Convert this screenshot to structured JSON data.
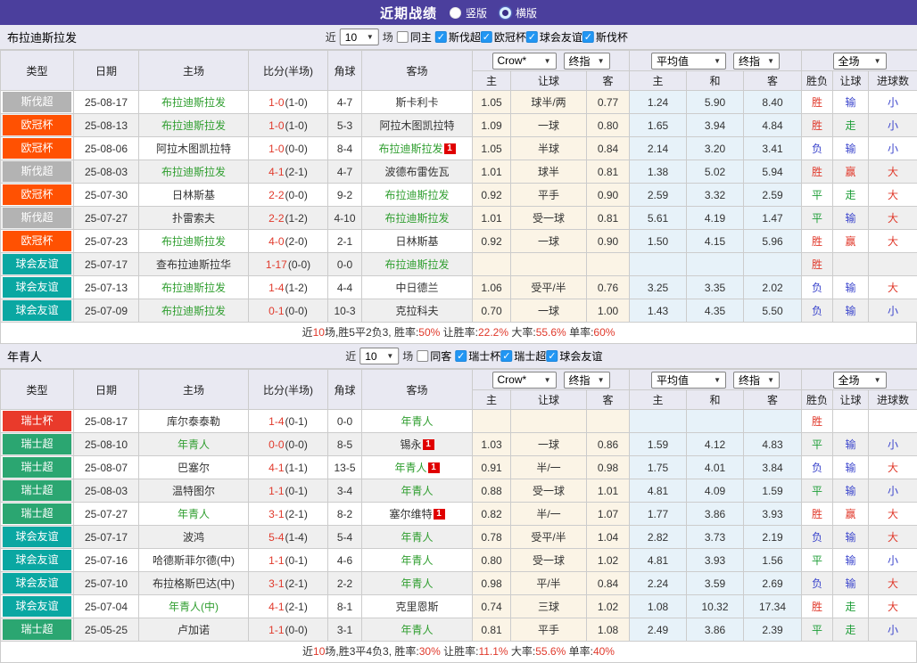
{
  "titlebar": {
    "title": "近期战绩",
    "radios": [
      {
        "label": "竖版",
        "checked": true
      },
      {
        "label": "横版",
        "checked": false
      }
    ]
  },
  "header": {
    "near_label": "近",
    "near_value": "10",
    "games_label": "场",
    "static_cols": [
      "类型",
      "日期",
      "主场",
      "比分(半场)",
      "角球",
      "客场"
    ],
    "selects": {
      "crow": "Crow*",
      "final1": "终指",
      "avg": "平均值",
      "final2": "终指",
      "scope": "全场"
    },
    "odds_cols": [
      "主",
      "让球",
      "客"
    ],
    "avg_cols": [
      "主",
      "和",
      "客"
    ],
    "result_cols": [
      "胜负",
      "让球",
      "进球数"
    ]
  },
  "league_colors": {
    "斯伐超": "#b3b3b3",
    "欧冠杯": "#ff5102",
    "球会友谊": "#0aa7a2",
    "瑞士杯": "#e93a2b",
    "瑞士超": "#2ba671"
  },
  "result_colors": {
    "red": "#e0392b",
    "green": "#1f9e38",
    "blue": "#3b45cc"
  },
  "sections": [
    {
      "team": "布拉迪斯拉发",
      "same_label": "同主",
      "same_checked": false,
      "leagues": [
        {
          "label": "斯伐超",
          "checked": true
        },
        {
          "label": "欧冠杯",
          "checked": true
        },
        {
          "label": "球会友谊",
          "checked": true
        },
        {
          "label": "斯伐杯",
          "checked": true
        }
      ],
      "rows": [
        {
          "league": "斯伐超",
          "date": "25-08-17",
          "home": "布拉迪斯拉发",
          "home_self": true,
          "home_card": 0,
          "score": "1-0",
          "half": "(1-0)",
          "corner": "4-7",
          "away": "斯卡利卡",
          "away_self": false,
          "away_card": 0,
          "odds": [
            "1.05",
            "球半/两",
            "0.77"
          ],
          "avg": [
            "1.24",
            "5.90",
            "8.40"
          ],
          "results": [
            [
              "胜",
              "red"
            ],
            [
              "输",
              "blue"
            ],
            [
              "小",
              "blue"
            ]
          ]
        },
        {
          "league": "欧冠杯",
          "date": "25-08-13",
          "home": "布拉迪斯拉发",
          "home_self": true,
          "home_card": 0,
          "score": "1-0",
          "half": "(1-0)",
          "corner": "5-3",
          "away": "阿拉木图凯拉特",
          "away_self": false,
          "away_card": 0,
          "odds": [
            "1.09",
            "一球",
            "0.80"
          ],
          "avg": [
            "1.65",
            "3.94",
            "4.84"
          ],
          "results": [
            [
              "胜",
              "red"
            ],
            [
              "走",
              "green"
            ],
            [
              "小",
              "blue"
            ]
          ]
        },
        {
          "league": "欧冠杯",
          "date": "25-08-06",
          "home": "阿拉木图凯拉特",
          "home_self": false,
          "home_card": 0,
          "score": "1-0",
          "half": "(0-0)",
          "corner": "8-4",
          "away": "布拉迪斯拉发",
          "away_self": true,
          "away_card": 1,
          "odds": [
            "1.05",
            "半球",
            "0.84"
          ],
          "avg": [
            "2.14",
            "3.20",
            "3.41"
          ],
          "results": [
            [
              "负",
              "blue"
            ],
            [
              "输",
              "blue"
            ],
            [
              "小",
              "blue"
            ]
          ]
        },
        {
          "league": "斯伐超",
          "date": "25-08-03",
          "home": "布拉迪斯拉发",
          "home_self": true,
          "home_card": 0,
          "score": "4-1",
          "half": "(2-1)",
          "corner": "4-7",
          "away": "波德布雷佐瓦",
          "away_self": false,
          "away_card": 0,
          "odds": [
            "1.01",
            "球半",
            "0.81"
          ],
          "avg": [
            "1.38",
            "5.02",
            "5.94"
          ],
          "results": [
            [
              "胜",
              "red"
            ],
            [
              "赢",
              "red"
            ],
            [
              "大",
              "red"
            ]
          ]
        },
        {
          "league": "欧冠杯",
          "date": "25-07-30",
          "home": "日林斯基",
          "home_self": false,
          "home_card": 0,
          "score": "2-2",
          "half": "(0-0)",
          "corner": "9-2",
          "away": "布拉迪斯拉发",
          "away_self": true,
          "away_card": 0,
          "odds": [
            "0.92",
            "平手",
            "0.90"
          ],
          "avg": [
            "2.59",
            "3.32",
            "2.59"
          ],
          "results": [
            [
              "平",
              "green"
            ],
            [
              "走",
              "green"
            ],
            [
              "大",
              "red"
            ]
          ]
        },
        {
          "league": "斯伐超",
          "date": "25-07-27",
          "home": "扑雷索夫",
          "home_self": false,
          "home_card": 0,
          "score": "2-2",
          "half": "(1-2)",
          "corner": "4-10",
          "away": "布拉迪斯拉发",
          "away_self": true,
          "away_card": 0,
          "odds": [
            "1.01",
            "受一球",
            "0.81"
          ],
          "avg": [
            "5.61",
            "4.19",
            "1.47"
          ],
          "results": [
            [
              "平",
              "green"
            ],
            [
              "输",
              "blue"
            ],
            [
              "大",
              "red"
            ]
          ]
        },
        {
          "league": "欧冠杯",
          "date": "25-07-23",
          "home": "布拉迪斯拉发",
          "home_self": true,
          "home_card": 0,
          "score": "4-0",
          "half": "(2-0)",
          "corner": "2-1",
          "away": "日林斯基",
          "away_self": false,
          "away_card": 0,
          "odds": [
            "0.92",
            "一球",
            "0.90"
          ],
          "avg": [
            "1.50",
            "4.15",
            "5.96"
          ],
          "results": [
            [
              "胜",
              "red"
            ],
            [
              "赢",
              "red"
            ],
            [
              "大",
              "red"
            ]
          ]
        },
        {
          "league": "球会友谊",
          "date": "25-07-17",
          "home": "查布拉迪斯拉华",
          "home_self": false,
          "home_card": 0,
          "score": "1-17",
          "half": "(0-0)",
          "corner": "0-0",
          "away": "布拉迪斯拉发",
          "away_self": true,
          "away_card": 0,
          "odds": [
            "",
            "",
            ""
          ],
          "avg": [
            "",
            "",
            ""
          ],
          "results": [
            [
              "胜",
              "red"
            ],
            [
              "",
              ""
            ],
            [
              "",
              ""
            ]
          ]
        },
        {
          "league": "球会友谊",
          "date": "25-07-13",
          "home": "布拉迪斯拉发",
          "home_self": true,
          "home_card": 0,
          "score": "1-4",
          "half": "(1-2)",
          "corner": "4-4",
          "away": "中日德兰",
          "away_self": false,
          "away_card": 0,
          "odds": [
            "1.06",
            "受平/半",
            "0.76"
          ],
          "avg": [
            "3.25",
            "3.35",
            "2.02"
          ],
          "results": [
            [
              "负",
              "blue"
            ],
            [
              "输",
              "blue"
            ],
            [
              "大",
              "red"
            ]
          ]
        },
        {
          "league": "球会友谊",
          "date": "25-07-09",
          "home": "布拉迪斯拉发",
          "home_self": true,
          "home_card": 0,
          "score": "0-1",
          "half": "(0-0)",
          "corner": "10-3",
          "away": "克拉科夫",
          "away_self": false,
          "away_card": 0,
          "odds": [
            "0.70",
            "一球",
            "1.00"
          ],
          "avg": [
            "1.43",
            "4.35",
            "5.50"
          ],
          "results": [
            [
              "负",
              "blue"
            ],
            [
              "输",
              "blue"
            ],
            [
              "小",
              "blue"
            ]
          ]
        }
      ],
      "summary": [
        [
          "近",
          "k"
        ],
        [
          "10",
          "r"
        ],
        [
          "场,胜5平2负3, 胜率:",
          "k"
        ],
        [
          "50%",
          "r"
        ],
        [
          " 让胜率:",
          "k"
        ],
        [
          "22.2%",
          "r"
        ],
        [
          " 大率:",
          "k"
        ],
        [
          "55.6%",
          "r"
        ],
        [
          " 单率:",
          "k"
        ],
        [
          "60%",
          "r"
        ]
      ]
    },
    {
      "team": "年青人",
      "same_label": "同客",
      "same_checked": false,
      "leagues": [
        {
          "label": "瑞士杯",
          "checked": true
        },
        {
          "label": "瑞士超",
          "checked": true
        },
        {
          "label": "球会友谊",
          "checked": true
        }
      ],
      "rows": [
        {
          "league": "瑞士杯",
          "date": "25-08-17",
          "home": "库尔泰泰勒",
          "home_self": false,
          "home_card": 0,
          "score": "1-4",
          "half": "(0-1)",
          "corner": "0-0",
          "away": "年青人",
          "away_self": true,
          "away_card": 0,
          "odds": [
            "",
            "",
            ""
          ],
          "avg": [
            "",
            "",
            ""
          ],
          "results": [
            [
              "胜",
              "red"
            ],
            [
              "",
              ""
            ],
            [
              "",
              ""
            ]
          ]
        },
        {
          "league": "瑞士超",
          "date": "25-08-10",
          "home": "年青人",
          "home_self": true,
          "home_card": 0,
          "score": "0-0",
          "half": "(0-0)",
          "corner": "8-5",
          "away": "锡永",
          "away_self": false,
          "away_card": 1,
          "odds": [
            "1.03",
            "一球",
            "0.86"
          ],
          "avg": [
            "1.59",
            "4.12",
            "4.83"
          ],
          "results": [
            [
              "平",
              "green"
            ],
            [
              "输",
              "blue"
            ],
            [
              "小",
              "blue"
            ]
          ]
        },
        {
          "league": "瑞士超",
          "date": "25-08-07",
          "home": "巴塞尔",
          "home_self": false,
          "home_card": 0,
          "score": "4-1",
          "half": "(1-1)",
          "corner": "13-5",
          "away": "年青人",
          "away_self": true,
          "away_card": 1,
          "odds": [
            "0.91",
            "半/一",
            "0.98"
          ],
          "avg": [
            "1.75",
            "4.01",
            "3.84"
          ],
          "results": [
            [
              "负",
              "blue"
            ],
            [
              "输",
              "blue"
            ],
            [
              "大",
              "red"
            ]
          ]
        },
        {
          "league": "瑞士超",
          "date": "25-08-03",
          "home": "温特图尔",
          "home_self": false,
          "home_card": 0,
          "score": "1-1",
          "half": "(0-1)",
          "corner": "3-4",
          "away": "年青人",
          "away_self": true,
          "away_card": 0,
          "odds": [
            "0.88",
            "受一球",
            "1.01"
          ],
          "avg": [
            "4.81",
            "4.09",
            "1.59"
          ],
          "results": [
            [
              "平",
              "green"
            ],
            [
              "输",
              "blue"
            ],
            [
              "小",
              "blue"
            ]
          ]
        },
        {
          "league": "瑞士超",
          "date": "25-07-27",
          "home": "年青人",
          "home_self": true,
          "home_card": 0,
          "score": "3-1",
          "half": "(2-1)",
          "corner": "8-2",
          "away": "塞尔维特",
          "away_self": false,
          "away_card": 1,
          "odds": [
            "0.82",
            "半/一",
            "1.07"
          ],
          "avg": [
            "1.77",
            "3.86",
            "3.93"
          ],
          "results": [
            [
              "胜",
              "red"
            ],
            [
              "赢",
              "red"
            ],
            [
              "大",
              "red"
            ]
          ]
        },
        {
          "league": "球会友谊",
          "date": "25-07-17",
          "home": "波鸿",
          "home_self": false,
          "home_card": 0,
          "score": "5-4",
          "half": "(1-4)",
          "corner": "5-4",
          "away": "年青人",
          "away_self": true,
          "away_card": 0,
          "odds": [
            "0.78",
            "受平/半",
            "1.04"
          ],
          "avg": [
            "2.82",
            "3.73",
            "2.19"
          ],
          "results": [
            [
              "负",
              "blue"
            ],
            [
              "输",
              "blue"
            ],
            [
              "大",
              "red"
            ]
          ]
        },
        {
          "league": "球会友谊",
          "date": "25-07-16",
          "home": "哈德斯菲尔德(中)",
          "home_self": false,
          "home_card": 0,
          "score": "1-1",
          "half": "(0-1)",
          "corner": "4-6",
          "away": "年青人",
          "away_self": true,
          "away_card": 0,
          "odds": [
            "0.80",
            "受一球",
            "1.02"
          ],
          "avg": [
            "4.81",
            "3.93",
            "1.56"
          ],
          "results": [
            [
              "平",
              "green"
            ],
            [
              "输",
              "blue"
            ],
            [
              "小",
              "blue"
            ]
          ]
        },
        {
          "league": "球会友谊",
          "date": "25-07-10",
          "home": "布拉格斯巴达(中)",
          "home_self": false,
          "home_card": 0,
          "score": "3-1",
          "half": "(2-1)",
          "corner": "2-2",
          "away": "年青人",
          "away_self": true,
          "away_card": 0,
          "odds": [
            "0.98",
            "平/半",
            "0.84"
          ],
          "avg": [
            "2.24",
            "3.59",
            "2.69"
          ],
          "results": [
            [
              "负",
              "blue"
            ],
            [
              "输",
              "blue"
            ],
            [
              "大",
              "red"
            ]
          ]
        },
        {
          "league": "球会友谊",
          "date": "25-07-04",
          "home": "年青人(中)",
          "home_self": true,
          "home_card": 0,
          "score": "4-1",
          "half": "(2-1)",
          "corner": "8-1",
          "away": "克里恩斯",
          "away_self": false,
          "away_card": 0,
          "odds": [
            "0.74",
            "三球",
            "1.02"
          ],
          "avg": [
            "1.08",
            "10.32",
            "17.34"
          ],
          "results": [
            [
              "胜",
              "red"
            ],
            [
              "走",
              "green"
            ],
            [
              "大",
              "red"
            ]
          ]
        },
        {
          "league": "瑞士超",
          "date": "25-05-25",
          "home": "卢加诺",
          "home_self": false,
          "home_card": 0,
          "score": "1-1",
          "half": "(0-0)",
          "corner": "3-1",
          "away": "年青人",
          "away_self": true,
          "away_card": 0,
          "odds": [
            "0.81",
            "平手",
            "1.08"
          ],
          "avg": [
            "2.49",
            "3.86",
            "2.39"
          ],
          "results": [
            [
              "平",
              "green"
            ],
            [
              "走",
              "green"
            ],
            [
              "小",
              "blue"
            ]
          ]
        }
      ],
      "summary": [
        [
          "近",
          "k"
        ],
        [
          "10",
          "r"
        ],
        [
          "场,胜3平4负3, 胜率:",
          "k"
        ],
        [
          "30%",
          "r"
        ],
        [
          " 让胜率:",
          "k"
        ],
        [
          "11.1%",
          "r"
        ],
        [
          " 大率:",
          "k"
        ],
        [
          "55.6%",
          "r"
        ],
        [
          " 单率:",
          "k"
        ],
        [
          "40%",
          "r"
        ]
      ]
    }
  ]
}
